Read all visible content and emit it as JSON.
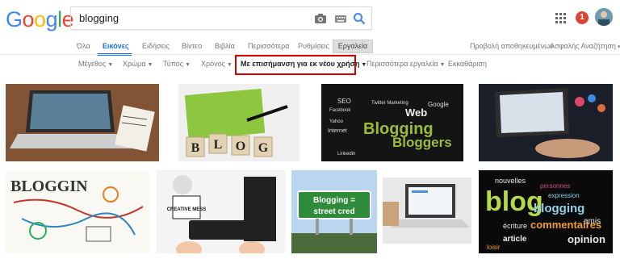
{
  "logo": {
    "letters": [
      "G",
      "o",
      "o",
      "g",
      "l",
      "e"
    ],
    "colors": [
      "#4285f4",
      "#ea4335",
      "#fbbc05",
      "#4285f4",
      "#34a853",
      "#ea4335"
    ]
  },
  "search": {
    "query": "blogging"
  },
  "header": {
    "notifications": "1"
  },
  "tabs": {
    "all": "Όλα",
    "images": "Εικόνες",
    "news": "Ειδήσεις",
    "videos": "Βίντεο",
    "books": "Βιβλία",
    "more": "Περισσότερα",
    "settings": "Ρυθμίσεις",
    "tools": "Εργαλεία",
    "saved": "Προβολή αποθηκευμένων",
    "safesearch": "Ασφαλής Αναζήτηση"
  },
  "filters": {
    "size": "Μέγεθος",
    "color": "Χρώμα",
    "type": "Τύπος",
    "time": "Χρόνος",
    "usage": "Με επισήμανση για εκ νέου χρήση",
    "more_tools": "Περισσότερα εργαλεία",
    "clear": "Εκκαθάριση"
  },
  "images": {
    "blog_blocks": "BLOG",
    "word_cloud": [
      "Blogging",
      "Bloggers",
      "Twitter Marketing",
      "SEO",
      "Facebook",
      "Web",
      "Yahoo",
      "Internet",
      "Google",
      "Linkedin"
    ],
    "sign": "Blogging = street cred",
    "french_cloud": [
      "blog",
      "blogging",
      "commentaires",
      "opinion",
      "article",
      "nouvelles",
      "personnes",
      "expression",
      "écriture",
      "amis",
      "loisir"
    ],
    "sketch": "BLOGGIN",
    "creative_mess": "CREATIVE MESS"
  },
  "colors": {
    "accent": "#1a73e8",
    "highlight": "#d40000",
    "notif": "#db4437"
  }
}
